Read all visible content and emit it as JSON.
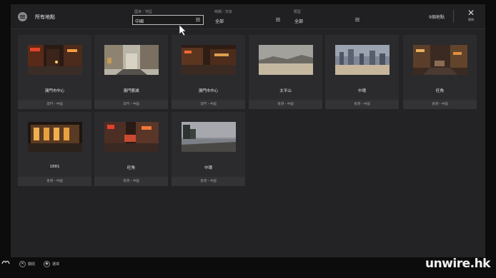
{
  "header": {
    "title": "所有地點",
    "filters": [
      {
        "label": "國家／地區",
        "value": "中國",
        "active": true
      },
      {
        "label": "時期／天氣",
        "value": "全部",
        "active": false
      },
      {
        "label": "類型",
        "value": "全部",
        "active": false
      }
    ],
    "count": "9個地點",
    "close_label": "關閉"
  },
  "locations": [
    {
      "name": "澳門市中心",
      "loc": "澳門・中國"
    },
    {
      "name": "澳門舊城",
      "loc": "澳門・中國"
    },
    {
      "name": "澳門市中心",
      "loc": "澳門・中國"
    },
    {
      "name": "太平山",
      "loc": "香港・中國"
    },
    {
      "name": "中環",
      "loc": "香港・中國"
    },
    {
      "name": "旺角",
      "loc": "香港・中國"
    },
    {
      "name": "1881",
      "loc": "香港・中國"
    },
    {
      "name": "旺角",
      "loc": "香港・中國"
    },
    {
      "name": "中環",
      "loc": "香港・中國"
    }
  ],
  "footer": {
    "back_label": "關閉",
    "select_label": "選擇"
  },
  "watermark": "unwire.hk"
}
